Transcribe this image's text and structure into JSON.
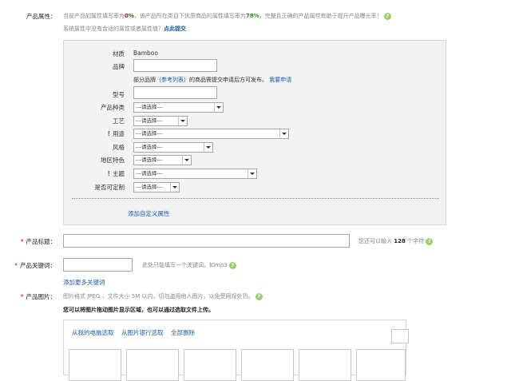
{
  "header": {
    "label": "产品属性：",
    "rate_line": {
      "prefix": "当前产品的属性填写率为",
      "rate": "0%",
      "middle": "，该产品所在类目下优质商品的属性填写率为",
      "good_rate": "78%",
      "suffix": "，完整且正确的产品属性有助于提升产品曝光率！"
    },
    "suggest_text": "系统属性中没有合适的属性或者属性值？",
    "suggest_link": "点此提交"
  },
  "attributes": {
    "material_label": "材质",
    "material_value": "Bamboo",
    "brand_label": "品牌",
    "brand_note_prefix": "部分品牌（",
    "brand_note_link": "参考列表",
    "brand_note_suffix": "）的商品需提交申请后方可发布。",
    "brand_apply": "我要申请",
    "model_label": "型号",
    "rows": [
      {
        "label": "产品种类",
        "value": "---请选择---",
        "required": false
      },
      {
        "label": "工艺",
        "value": "---请选择---",
        "required": false
      },
      {
        "label": "用途",
        "value": "---请选择---",
        "required": true
      },
      {
        "label": "风格",
        "value": "---请选择---",
        "required": false
      },
      {
        "label": "地区特色",
        "value": "---请选择---",
        "required": false
      },
      {
        "label": "主题",
        "value": "---请选择---",
        "required": true
      },
      {
        "label": "是否可定制",
        "value": "---请选择---",
        "required": false
      }
    ],
    "required_mark": "!",
    "add_custom": "添加自定义属性"
  },
  "title_field": {
    "star": "*",
    "label": "产品标题：",
    "hint_prefix": "您还可以输入",
    "hint_count": "128",
    "hint_suffix": "个字符"
  },
  "keyword_field": {
    "star": "*",
    "label": "产品关键词：",
    "hint": "此处只能填写一个关键词，如mp3",
    "add_more": "添加更多关键词"
  },
  "image_field": {
    "star": "*",
    "label": "产品图片：",
    "format_note": "图片格式 JPEG ，文件大小 5M 以内，切勿盗用他人图片，以免受网规处罚。",
    "drag_note": "您可以将图片拖动图片显示区域，也可以通过选取文件上传。",
    "tabs": [
      "从我的电脑选取",
      "从图片银行选取",
      "全部删除"
    ]
  },
  "help_icon": "?"
}
